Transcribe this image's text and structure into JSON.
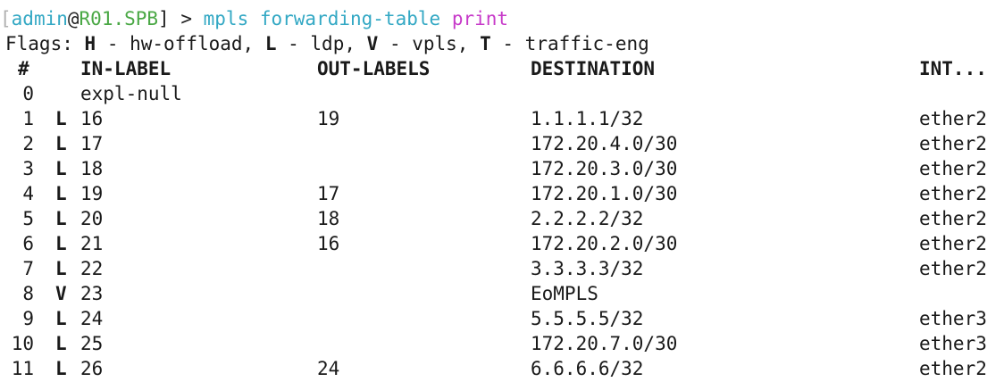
{
  "prompt": {
    "bracket_open": "[",
    "user": "admin",
    "at": "@",
    "host": "R01.SPB",
    "bracket_close": "]",
    "arrow": " > ",
    "command": "mpls forwarding-table",
    "subcommand": "print"
  },
  "flags": {
    "prefix": "Flags: ",
    "items": [
      {
        "key": "H",
        "desc": " - hw-offload, "
      },
      {
        "key": "L",
        "desc": " - ldp, "
      },
      {
        "key": "V",
        "desc": " - vpls, "
      },
      {
        "key": "T",
        "desc": " - traffic-eng"
      }
    ]
  },
  "table": {
    "headers": {
      "num": "#",
      "in_label": "IN-LABEL",
      "out_labels": "OUT-LABELS",
      "destination": "DESTINATION",
      "interface": "INT..."
    },
    "rows": [
      {
        "num": "0",
        "flag": "",
        "in": "expl-null",
        "out": "",
        "dest": "",
        "int": ""
      },
      {
        "num": "1",
        "flag": "L",
        "in": "16",
        "out": "19",
        "dest": "1.1.1.1/32",
        "int": "ether2"
      },
      {
        "num": "2",
        "flag": "L",
        "in": "17",
        "out": "",
        "dest": "172.20.4.0/30",
        "int": "ether2"
      },
      {
        "num": "3",
        "flag": "L",
        "in": "18",
        "out": "",
        "dest": "172.20.3.0/30",
        "int": "ether2"
      },
      {
        "num": "4",
        "flag": "L",
        "in": "19",
        "out": "17",
        "dest": "172.20.1.0/30",
        "int": "ether2"
      },
      {
        "num": "5",
        "flag": "L",
        "in": "20",
        "out": "18",
        "dest": "2.2.2.2/32",
        "int": "ether2"
      },
      {
        "num": "6",
        "flag": "L",
        "in": "21",
        "out": "16",
        "dest": "172.20.2.0/30",
        "int": "ether2"
      },
      {
        "num": "7",
        "flag": "L",
        "in": "22",
        "out": "",
        "dest": "3.3.3.3/32",
        "int": "ether2"
      },
      {
        "num": "8",
        "flag": "V",
        "in": "23",
        "out": "",
        "dest": "EoMPLS",
        "int": ""
      },
      {
        "num": "9",
        "flag": "L",
        "in": "24",
        "out": "",
        "dest": "5.5.5.5/32",
        "int": "ether3"
      },
      {
        "num": "10",
        "flag": "L",
        "in": "25",
        "out": "",
        "dest": "172.20.7.0/30",
        "int": "ether3"
      },
      {
        "num": "11",
        "flag": "L",
        "in": "26",
        "out": "24",
        "dest": "6.6.6.6/32",
        "int": "ether2"
      }
    ]
  }
}
